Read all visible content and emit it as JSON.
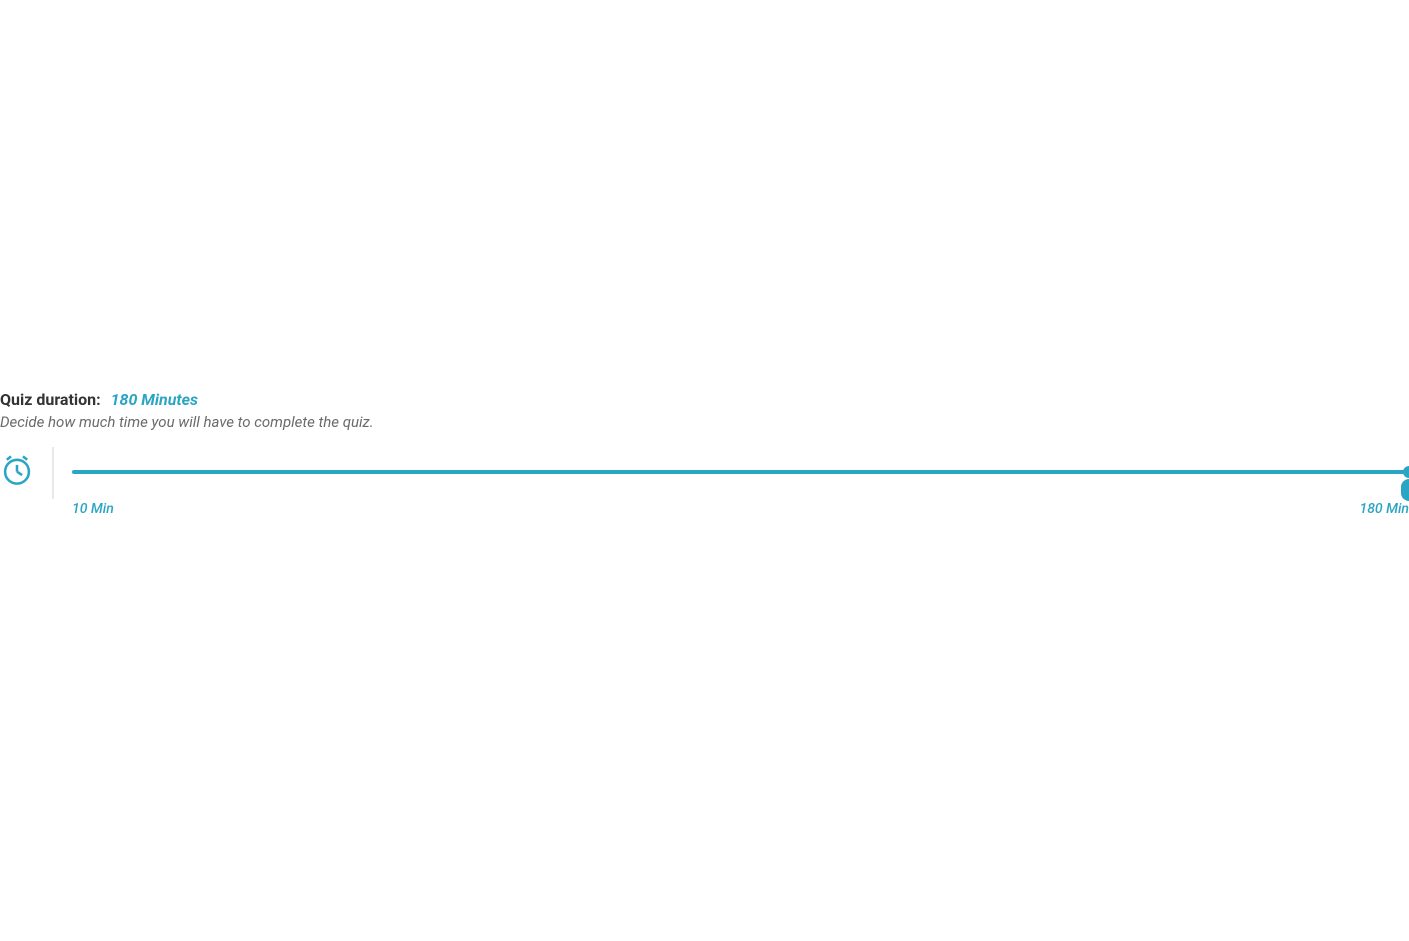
{
  "duration": {
    "label": "Quiz duration:",
    "value": "180 Minutes",
    "description": "Decide how much time you will have to complete the quiz."
  },
  "slider": {
    "min_label": "10 Min",
    "max_label": "180 Min",
    "min_value": 10,
    "max_value": 180,
    "current_value": 180
  },
  "colors": {
    "accent": "#2ba5c4",
    "text": "#333333",
    "muted": "#6a6a6a"
  }
}
